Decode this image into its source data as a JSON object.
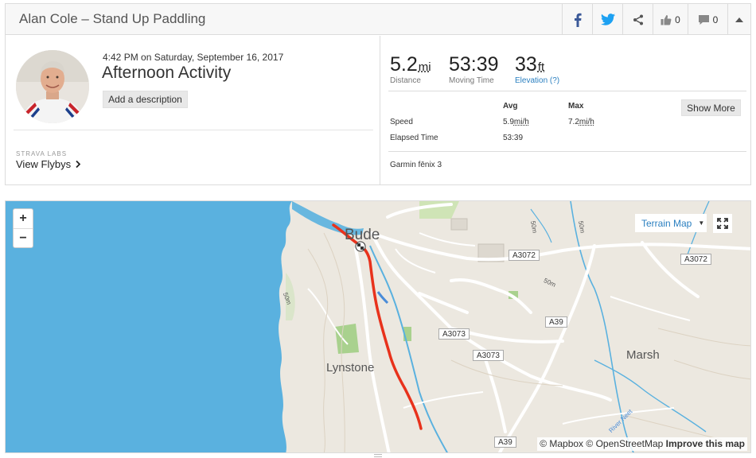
{
  "header": {
    "title": "Alan Cole – Stand Up Paddling",
    "kudos_count": "0",
    "comments_count": "0"
  },
  "activity": {
    "date": "4:42 PM on Saturday, September 16, 2017",
    "name": "Afternoon Activity",
    "add_description_label": "Add a description",
    "labs_label": "STRAVA LABS",
    "flybys_label": "View Flybys"
  },
  "stats": [
    {
      "value": "5.2",
      "unit": "mi",
      "label": "Distance"
    },
    {
      "value": "53:39",
      "unit": "",
      "label": "Moving Time"
    },
    {
      "value": "33",
      "unit": "ft",
      "label": "Elevation (?)"
    }
  ],
  "table": {
    "col_avg": "Avg",
    "col_max": "Max",
    "rows": [
      {
        "label": "Speed",
        "avg": "5.9",
        "avg_unit": "mi/h",
        "max": "7.2",
        "max_unit": "mi/h"
      },
      {
        "label": "Elapsed Time",
        "avg": "53:39",
        "avg_unit": "",
        "max": "",
        "max_unit": ""
      }
    ],
    "show_more_label": "Show More",
    "device": "Garmin fēnix 3"
  },
  "map": {
    "zoom_in": "+",
    "zoom_out": "−",
    "terrain_label": "Terrain Map",
    "attribution_mapbox": "© Mapbox",
    "attribution_osm": "© OpenStreetMap",
    "attribution_improve": "Improve this map",
    "places": {
      "bude": "Bude",
      "lynstone": "Lynstone",
      "marsh": "Marsh"
    },
    "roads": {
      "a3072_1": "A3072",
      "a3072_2": "A3072",
      "a3073_1": "A3073",
      "a3073_2": "A3073",
      "a39_1": "A39",
      "a39_2": "A39"
    },
    "contours": {
      "c1": "50m",
      "c2": "50m",
      "c3": "50m",
      "c4": "50m"
    },
    "river": "River Neet"
  },
  "colors": {
    "route": "#e8321c",
    "sea": "#5ab1df",
    "land": "#ece8e0",
    "link": "#2a7fc0",
    "facebook": "#3b5998",
    "twitter": "#1da1f2"
  }
}
